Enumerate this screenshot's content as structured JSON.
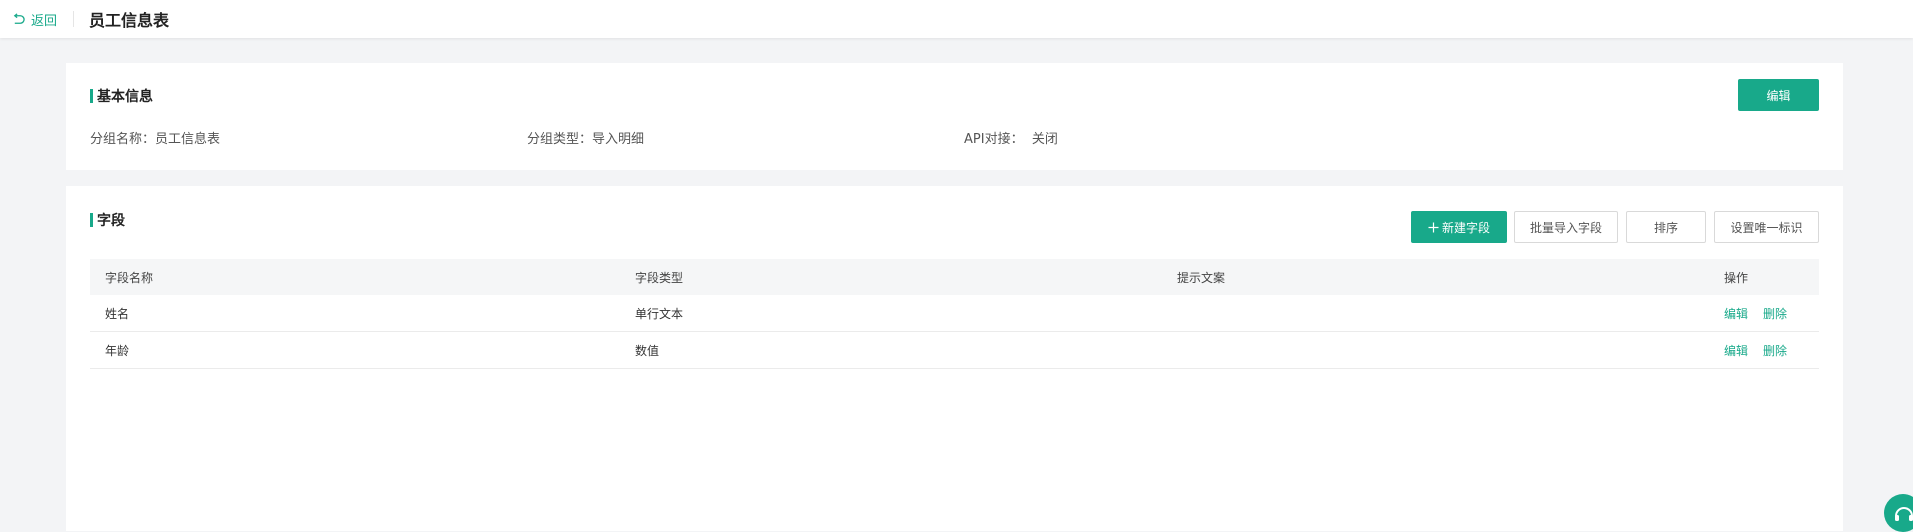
{
  "header": {
    "back_label": "返回",
    "page_title": "员工信息表"
  },
  "basic_info": {
    "title": "基本信息",
    "edit_label": "编辑",
    "group_name": "分组名称：员工信息表",
    "group_type": "分组类型：导入明细",
    "api": "API对接：  关闭"
  },
  "fields": {
    "title": "字段",
    "new_field_label": "新建字段",
    "batch_import_label": "批量导入字段",
    "sort_label": "排序",
    "unique_label": "设置唯一标识",
    "columns": [
      "字段名称",
      "字段类型",
      "提示文案",
      "操作"
    ],
    "rows": [
      {
        "name": "姓名",
        "type": "单行文本",
        "hint": "",
        "edit": "编辑",
        "delete": "删除"
      },
      {
        "name": "年龄",
        "type": "数值",
        "hint": "",
        "edit": "编辑",
        "delete": "删除"
      }
    ]
  },
  "colors": {
    "accent": "#18a98a",
    "background": "#f3f4f6"
  },
  "icons": {
    "back": "undo-arrow-icon",
    "plus": "plus-icon",
    "help": "headset-icon"
  }
}
